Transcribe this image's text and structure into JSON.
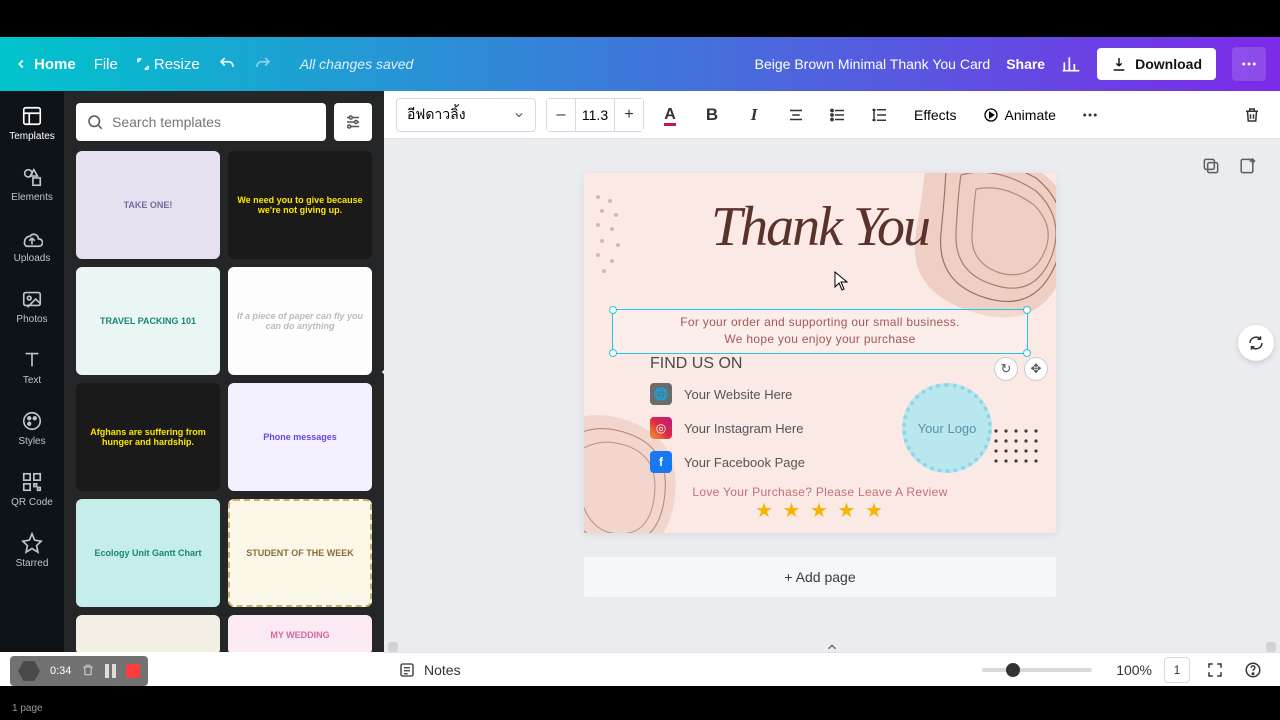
{
  "header": {
    "home": "Home",
    "file": "File",
    "resize": "Resize",
    "status": "All changes saved",
    "title": "Beige Brown Minimal Thank You Card",
    "share": "Share",
    "download": "Download"
  },
  "rail": {
    "templates": "Templates",
    "elements": "Elements",
    "uploads": "Uploads",
    "photos": "Photos",
    "text": "Text",
    "styles": "Styles",
    "qrcode": "QR Code",
    "starred": "Starred"
  },
  "search": {
    "placeholder": "Search templates"
  },
  "templates": {
    "t1": "TAKE ONE!",
    "t2": "We need you to give because we're not giving up.",
    "t3": "TRAVEL PACKING 101",
    "t4": "If a piece of paper can fly you can do anything",
    "t5": "Afghans are suffering from hunger and hardship.",
    "t6": "Phone messages",
    "t7": "Ecology Unit Gantt Chart",
    "t8": "STUDENT OF THE WEEK",
    "t10": "MY WEDDING"
  },
  "toolbar": {
    "font": "อีฟดาวลิ้ง",
    "size": "11.3",
    "effects": "Effects",
    "animate": "Animate"
  },
  "card": {
    "thank": "Thank You",
    "sub1": "For your order and supporting our small business.",
    "sub2": "We hope you enjoy your purchase",
    "findus": "FIND US ON",
    "website": "Your Website Here",
    "instagram": "Your Instagram Here",
    "facebook": "Your Facebook Page",
    "logo": "Your Logo",
    "review": "Love Your Purchase? Please Leave A Review",
    "stars": "★ ★ ★ ★ ★"
  },
  "addpage": "+ Add page",
  "bottom": {
    "notes": "Notes",
    "zoom": "100%",
    "pagecount": "1"
  },
  "rec": {
    "time": "0:34",
    "pages": "1 page"
  }
}
